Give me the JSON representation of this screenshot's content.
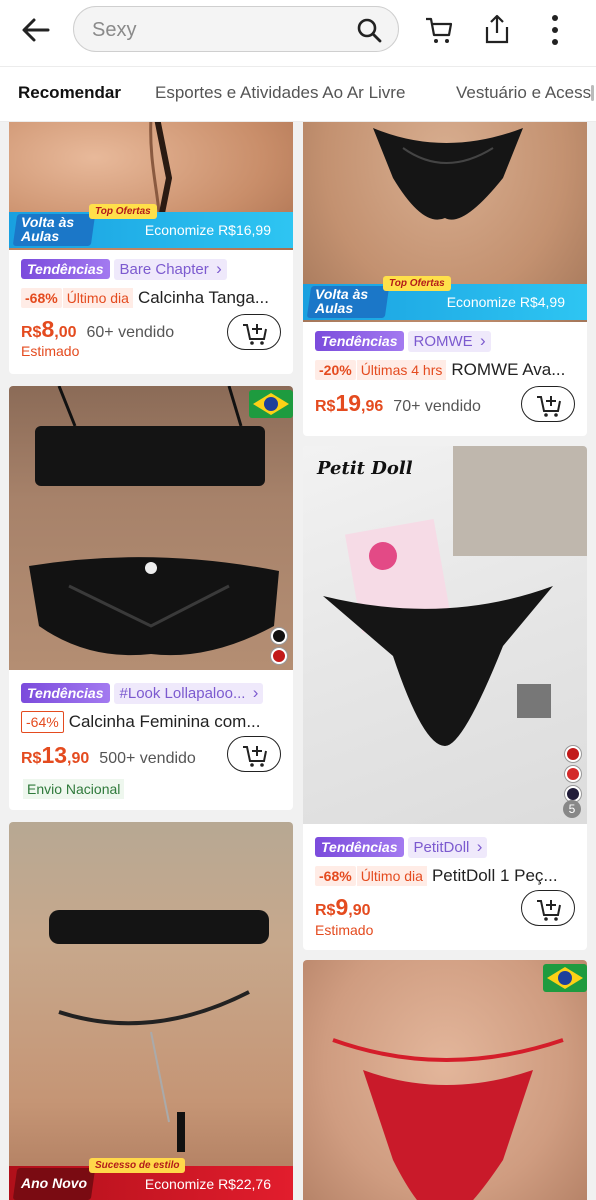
{
  "search": {
    "placeholder": "Sexy"
  },
  "tabs": [
    "Recomendar",
    "Esportes e Atividades Ao Ar Livre",
    "Vestuário e Acess"
  ],
  "products": [
    {
      "banner": {
        "title1": "Volta às",
        "title2": "Aulas",
        "top": "Top Ofertas",
        "save": "Economize R$16,99"
      },
      "trend": "Tendências",
      "store": "Bare Chapter",
      "discount": "-68%",
      "deal": "Último dia",
      "title": "Calcinha Tanga...",
      "currency": "R$",
      "price_int": "8",
      "price_dec": ",00",
      "sold": "60+ vendido",
      "note": "Estimado"
    },
    {
      "trend": "Tendências",
      "store": "#Look Lollapaloo...",
      "discount": "-64%",
      "title": "Calcinha Feminina com...",
      "currency": "R$",
      "price_int": "13",
      "price_dec": ",90",
      "sold": "500+ vendido",
      "note": "Envio Nacional"
    },
    {
      "banner": {
        "title1": "Ano Novo",
        "top": "Sucesso de estilo",
        "save": "Economize R$22,76"
      }
    },
    {
      "banner": {
        "title1": "Volta às",
        "title2": "Aulas",
        "top": "Top Ofertas",
        "save": "Economize R$4,99"
      },
      "trend": "Tendências",
      "store": "ROMWE",
      "discount": "-20%",
      "deal": "Últimas 4 hrs",
      "title": "ROMWE Ava...",
      "currency": "R$",
      "price_int": "19",
      "price_dec": ",96",
      "sold": "70+ vendido"
    },
    {
      "image_text": "Petit Doll",
      "swatch_count": "5",
      "trend": "Tendências",
      "store": "PetitDoll",
      "discount": "-68%",
      "deal": "Último dia",
      "title": "PetitDoll 1 Peç...",
      "currency": "R$",
      "price_int": "9",
      "price_dec": ",90",
      "note": "Estimado"
    },
    {}
  ],
  "colors": {
    "price": "#e44b1f",
    "trend": "#7b4bdc",
    "banner_blue": "#19a0e0",
    "banner_red": "#c3121f"
  }
}
